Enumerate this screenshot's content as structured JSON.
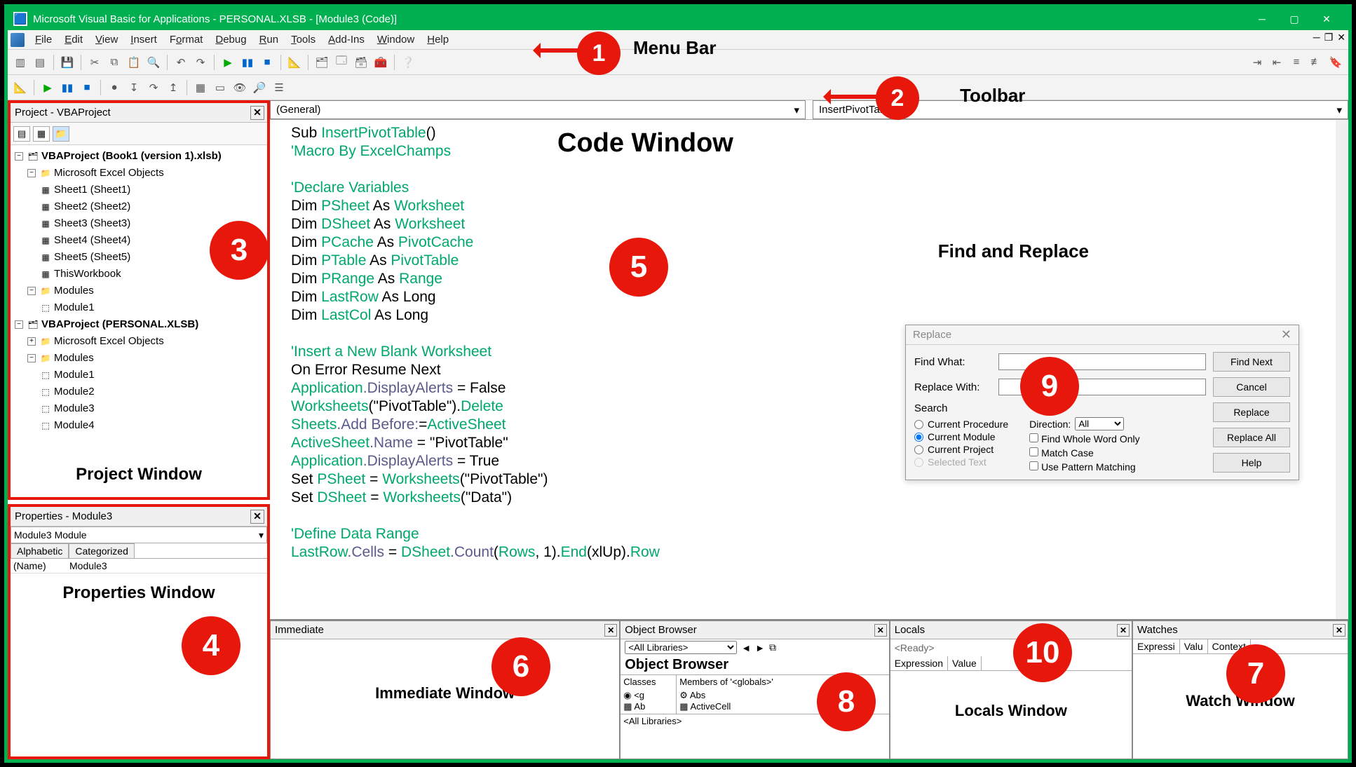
{
  "title": "Microsoft Visual Basic for Applications - PERSONAL.XLSB - [Module3 (Code)]",
  "menus": [
    "File",
    "Edit",
    "View",
    "Insert",
    "Format",
    "Debug",
    "Run",
    "Tools",
    "Add-Ins",
    "Window",
    "Help"
  ],
  "annot": {
    "menubar": "Menu Bar",
    "toolbar": "Toolbar",
    "project": "Project Window",
    "properties": "Properties Window",
    "code": "Code Window",
    "immediate": "Immediate Window",
    "watch": "Watch Window",
    "objbrowser": "Object Browser",
    "findreplace": "Find and Replace",
    "locals": "Locals Window"
  },
  "callouts": {
    "c1": "1",
    "c2": "2",
    "c3": "3",
    "c4": "4",
    "c5": "5",
    "c6": "6",
    "c7": "7",
    "c8": "8",
    "c9": "9",
    "c10": "10"
  },
  "project": {
    "title": "Project - VBAProject",
    "tree": {
      "p1": "VBAProject (Book1 (version 1).xlsb)",
      "p1_objs": "Microsoft Excel Objects",
      "sheets": [
        "Sheet1 (Sheet1)",
        "Sheet2 (Sheet2)",
        "Sheet3 (Sheet3)",
        "Sheet4 (Sheet4)",
        "Sheet5 (Sheet5)",
        "ThisWorkbook"
      ],
      "p1_mods": "Modules",
      "p1_mod_items": [
        "Module1"
      ],
      "p2": "VBAProject (PERSONAL.XLSB)",
      "p2_objs": "Microsoft Excel Objects",
      "p2_mods": "Modules",
      "p2_mod_items": [
        "Module1",
        "Module2",
        "Module3",
        "Module4"
      ]
    }
  },
  "properties": {
    "title": "Properties - Module3",
    "combo": "Module3 Module",
    "tabs": [
      "Alphabetic",
      "Categorized"
    ],
    "rows": [
      {
        "k": "(Name)",
        "v": "Module3"
      }
    ]
  },
  "code": {
    "combo_left": "(General)",
    "combo_right": "InsertPivotTable",
    "lines": [
      {
        "t": "Sub ",
        "i": "InsertPivotTable",
        "t2": "()"
      },
      {
        "c": "'Macro By ExcelChamps"
      },
      {
        "blank": true
      },
      {
        "c": "'Declare Variables"
      },
      {
        "t": "Dim ",
        "i": "PSheet",
        "t2": " As ",
        "i2": "Worksheet"
      },
      {
        "t": "Dim ",
        "i": "DSheet",
        "t2": " As ",
        "i2": "Worksheet"
      },
      {
        "t": "Dim ",
        "i": "PCache",
        "t2": " As ",
        "i2": "PivotCache"
      },
      {
        "t": "Dim ",
        "i": "PTable",
        "t2": " As ",
        "i2": "PivotTable"
      },
      {
        "t": "Dim ",
        "i": "PRange",
        "t2": " As ",
        "i2": "Range"
      },
      {
        "t": "Dim ",
        "i": "LastRow",
        "t2": " As Long"
      },
      {
        "t": "Dim ",
        "i": "LastCol",
        "t2": " As Long"
      },
      {
        "blank": true
      },
      {
        "c": "'Insert a New Blank Worksheet"
      },
      {
        "t": "On Error Resume Next"
      },
      {
        "i": "Application",
        "m": ".DisplayAlerts",
        "t2": " = False"
      },
      {
        "i": "Worksheets",
        "t2": "(\"PivotTable\").",
        "i2": "Delete"
      },
      {
        "i": "Sheets",
        "m": ".Add Before:",
        "t2": "=",
        "i2": "ActiveSheet"
      },
      {
        "i": "ActiveSheet",
        "m": ".Name",
        "t2": " = \"PivotTable\""
      },
      {
        "i": "Application",
        "m": ".DisplayAlerts",
        "t2": " = True"
      },
      {
        "t": "Set ",
        "i": "PSheet",
        "t2": " = ",
        "i2": "Worksheets",
        "t3": "(\"PivotTable\")"
      },
      {
        "t": "Set ",
        "i": "DSheet",
        "t2": " = ",
        "i2": "Worksheets",
        "t3": "(\"Data\")"
      },
      {
        "blank": true
      },
      {
        "c": "'Define Data Range"
      },
      {
        "i": "LastRow",
        "t2": " = ",
        "i2": "DSheet",
        "m": ".Cells",
        "t3": "(",
        "i3": "Rows",
        "m2": ".Count",
        "t4": ", 1).",
        "i4": "End",
        "t5": "(xlUp).",
        "i5": "Row"
      }
    ]
  },
  "immediate": {
    "title": "Immediate"
  },
  "objbrowser": {
    "title": "Object Browser",
    "lib": "<All Libraries>",
    "classes_hdr": "Classes",
    "members_hdr": "Members of '<globals>'",
    "members": [
      "Abs",
      "ActiveCell"
    ],
    "status": "<All Libraries>"
  },
  "locals": {
    "title": "Locals",
    "ready": "<Ready>",
    "cols": [
      "Expression",
      "Value"
    ]
  },
  "watches": {
    "title": "Watches",
    "cols": [
      "Expressi",
      "Valu",
      "Context"
    ]
  },
  "replace": {
    "title": "Replace",
    "find_lbl": "Find What:",
    "repl_lbl": "Replace With:",
    "search_lbl": "Search",
    "dir_lbl": "Direction:",
    "dir_val": "All",
    "radios": [
      "Current Procedure",
      "Current Module",
      "Current Project",
      "Selected Text"
    ],
    "checks": [
      "Find Whole Word Only",
      "Match Case",
      "Use Pattern Matching"
    ],
    "btns": {
      "findnext": "Find Next",
      "cancel": "Cancel",
      "replace": "Replace",
      "replaceall": "Replace All",
      "help": "Help"
    }
  }
}
